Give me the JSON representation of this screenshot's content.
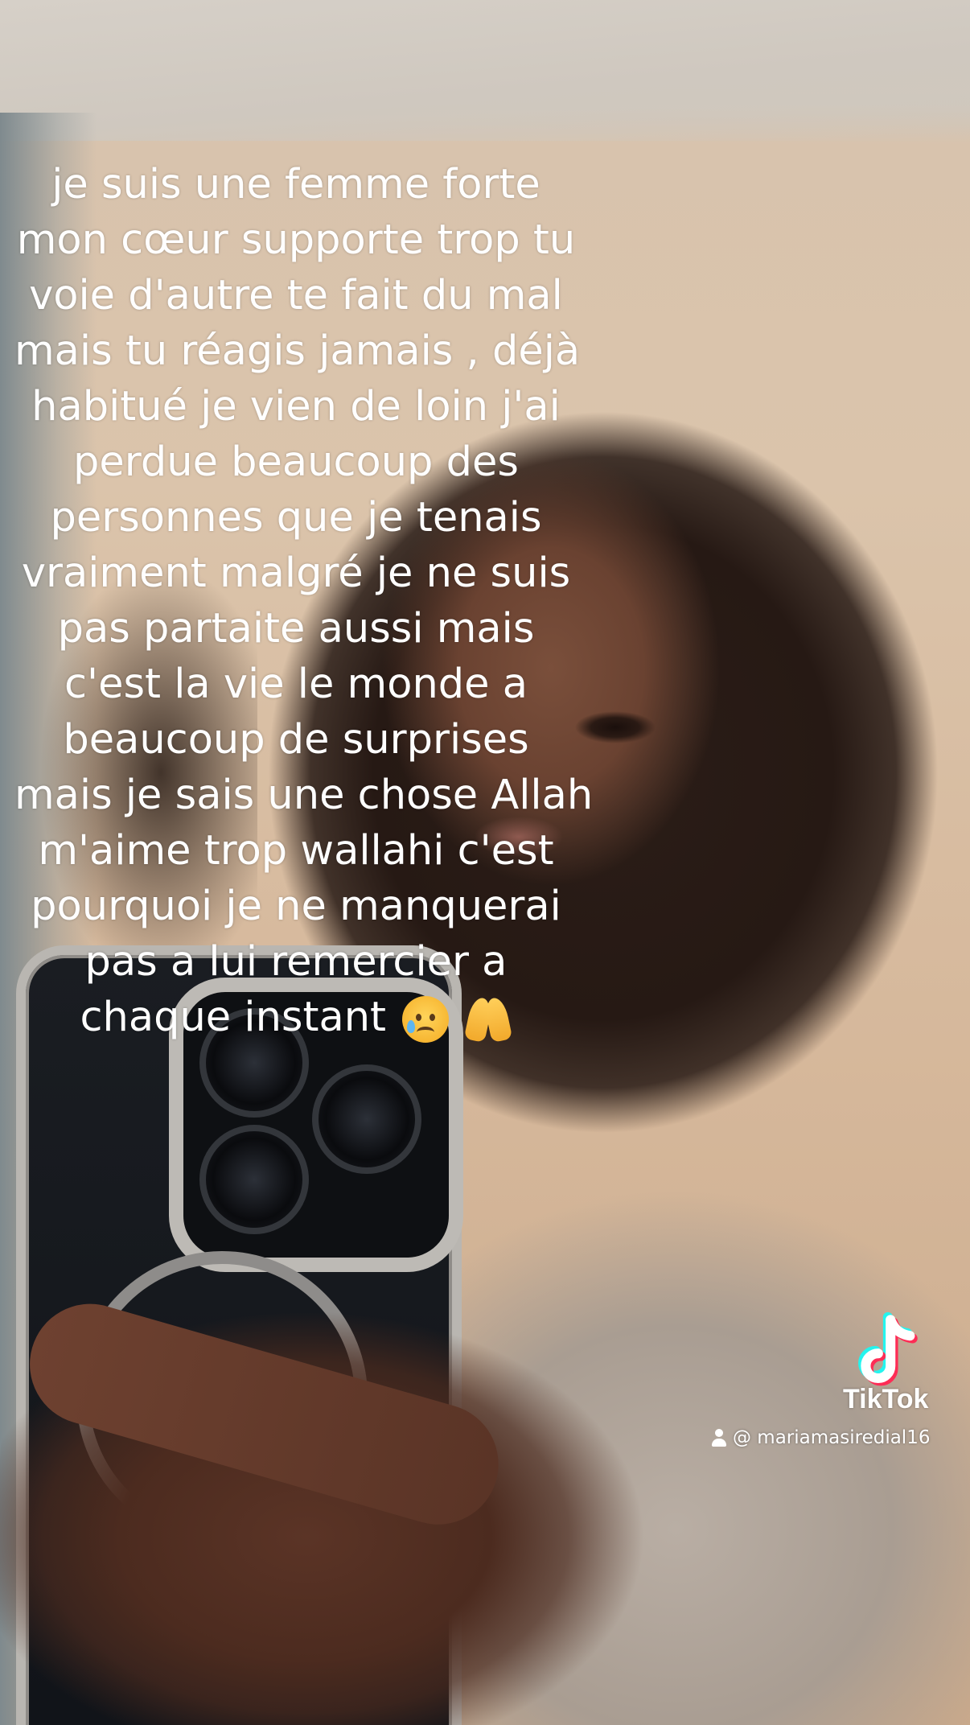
{
  "caption": {
    "lines": [
      "je suis une femme forte",
      "mon cœur supporte trop tu",
      "voie d'autre te fait du mal",
      "mais tu réagis jamais , déjà",
      "habitué je vien de loin j'ai",
      "perdue beaucoup des",
      "personnes que je tenais",
      "vraiment malgré je ne suis",
      "pas partaite aussi mais",
      "c'est la vie le monde a",
      "beaucoup de surprises",
      "mais je sais une chose Allah",
      "m'aime trop wallahi c'est",
      "pourquoi je ne manquerai",
      "pas a lui remercier a",
      "chaque instant"
    ],
    "emojis": [
      "sad-relieved-face-emoji",
      "folded-hands-emoji"
    ]
  },
  "watermark": {
    "brand": "TikTok",
    "handle": "@ mariamasiredial16",
    "icon": "tiktok-logo-icon",
    "user_icon": "user-icon",
    "colors": {
      "cyan": "#25F4EE",
      "red": "#FE2C55",
      "white": "#FFFFFF"
    }
  }
}
